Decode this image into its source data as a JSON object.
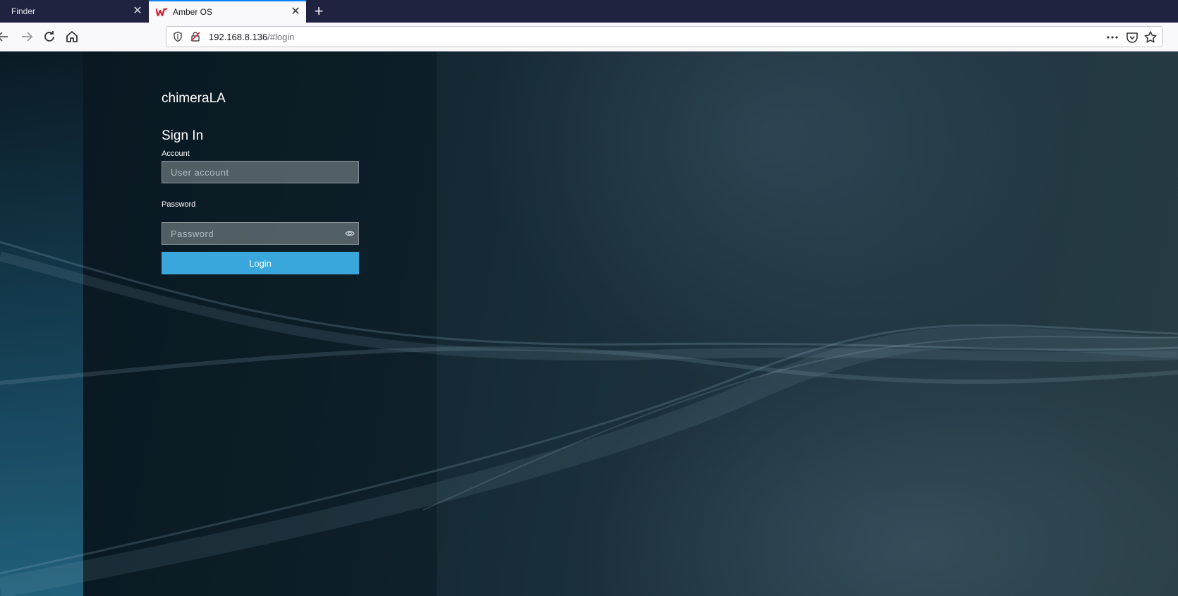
{
  "browser": {
    "tabs": [
      {
        "label": "Finder",
        "active": false
      },
      {
        "label": "Amber OS",
        "active": true
      }
    ],
    "url": {
      "host": "192.168.8.136",
      "path": "/#login"
    }
  },
  "login": {
    "brand": "chimeraLA",
    "heading": "Sign In",
    "account_label": "Account",
    "account_placeholder": "User account",
    "password_label": "Password",
    "password_placeholder": "Password",
    "submit_label": "Login"
  },
  "colors": {
    "accent": "#3aa7dc",
    "tabbar": "#202340",
    "active_tab_border": "#0a84ff"
  }
}
